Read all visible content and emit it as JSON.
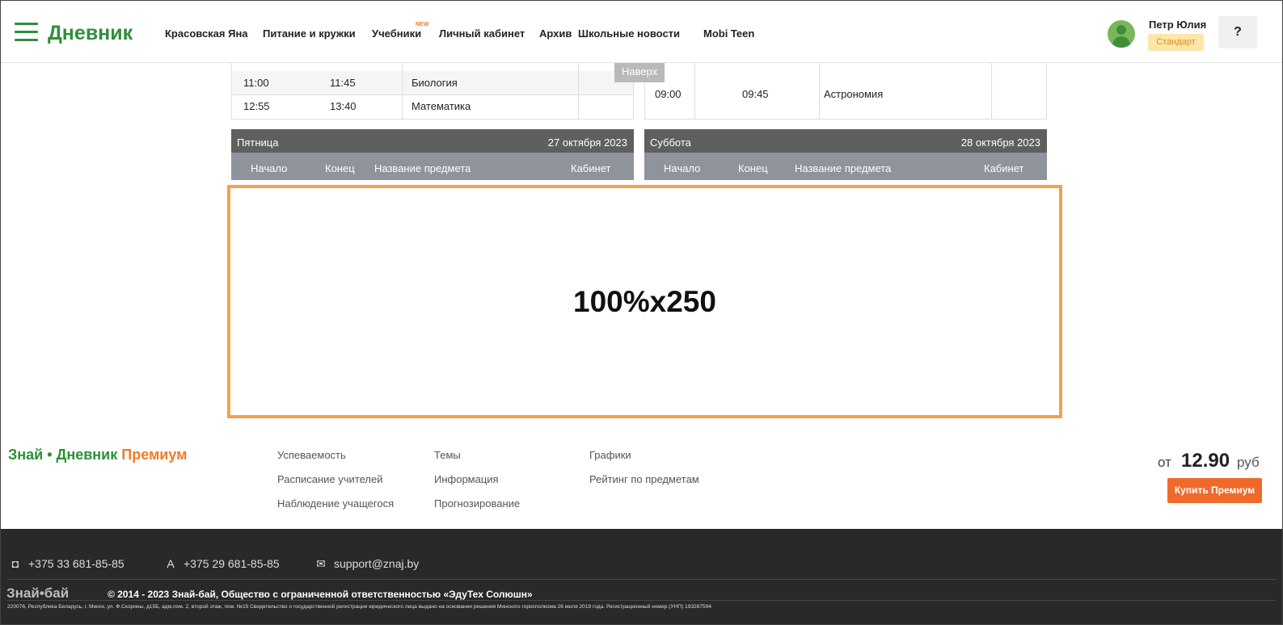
{
  "header": {
    "logo": "Дневник",
    "nav": [
      "Красовская Яна",
      "Питание и кружки",
      "Учебники",
      "Личный кабинет",
      "Архив",
      "Школьные новости",
      "Mobi Teen"
    ],
    "new_badge": "NEW",
    "user_name": "Петр Юлия",
    "user_plan": "Стандарт",
    "help": "?"
  },
  "scroll_top": "Наверх",
  "thursday_rows": [
    {
      "start": "11:00",
      "end": "11:45",
      "subject": "Биология",
      "room": ""
    },
    {
      "start": "12:55",
      "end": "13:40",
      "subject": "Математика",
      "room": ""
    }
  ],
  "friday_rows_above": [
    {
      "start": "09:00",
      "end": "09:45",
      "subject": "Астрономия",
      "room": ""
    }
  ],
  "days": [
    {
      "name": "Пятница",
      "date": "27 октября 2023"
    },
    {
      "name": "Суббота",
      "date": "28 октября 2023"
    }
  ],
  "columns": {
    "start": "Начало",
    "end": "Конец",
    "subject": "Название предмета",
    "room": "Кабинет"
  },
  "ad_label": "100%x250",
  "premium": {
    "logo_left": "Знай • Дневник",
    "logo_right": "Премиум",
    "links": [
      "Успеваемость",
      "Расписание учителей",
      "Наблюдение учащегося",
      "Темы",
      "Информация",
      "Прогнозирование",
      "Графики",
      "Рейтинг по предметам"
    ],
    "price_from": "от",
    "price": "12.90",
    "currency": "руб",
    "buy": "Купить Премиум"
  },
  "footer": {
    "phone1": "+375 33 681-85-85",
    "phone2": "+375 29 681-85-85",
    "email": "support@znaj.by",
    "logo": "Знай•бай",
    "copyright": "© 2014 - 2023 Знай-бай, Общество с ограниченной ответственностью «ЭдуТех Солюшн»",
    "address": "220076, Республика Беларусь, г. Минск, ул. Ф.Скорины, д15Б, адм.пом. 2, второй этаж, пом. №15 Свидетельство о государственной регистрации юридического лица выдано на основании решения Минского горисполкома 26 июля 2019 года. Регистрационный номер (УНП) 193287594"
  }
}
